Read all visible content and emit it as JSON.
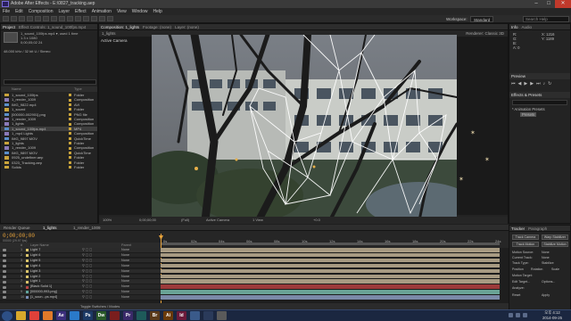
{
  "window": {
    "title": "Adobe After Effects - E:\\0827_tracking.aep",
    "min": "–",
    "max": "□",
    "close": "✕"
  },
  "menu": [
    "File",
    "Edit",
    "Composition",
    "Layer",
    "Effect",
    "Animation",
    "View",
    "Window",
    "Help"
  ],
  "toolbar": {
    "workspace_label": "Workspace:",
    "workspace_value": "Standard",
    "search_placeholder": "Search Help"
  },
  "project": {
    "tabs": [
      "Project",
      "Effect Controls: 1_sound_100fps.mp4"
    ],
    "item_name": "1_sound_100fps.mp4 ▾, used 1 time",
    "item_info1": "1.3 x 1080",
    "item_info2": "0;00;05;02 24",
    "item_info3": "48.000 kHz / 32 bit U / Stereo",
    "columns": {
      "name": "Name",
      "label": "",
      "type": "Type"
    },
    "items": [
      {
        "name": "1_sound_100fps",
        "type": "Folder",
        "color": "#c9a43b",
        "icon": "folder-icon"
      },
      {
        "name": "1_render_1009",
        "type": "Composition",
        "color": "#8a7ab8",
        "icon": "composition-icon"
      },
      {
        "name": "IMG_9822.mp4",
        "type": "AVI",
        "color": "#5a8fc9",
        "icon": "footage-icon"
      },
      {
        "name": "1_sound",
        "type": "Folder",
        "color": "#c9a43b",
        "icon": "folder-icon"
      },
      {
        "name": "[000000-002901].png",
        "type": "PNG file",
        "color": "#5a8fc9",
        "icon": "footage-icon"
      },
      {
        "name": "1_render_1009",
        "type": "Composition",
        "color": "#8a7ab8",
        "icon": "composition-icon"
      },
      {
        "name": "1_lights",
        "type": "Composition",
        "color": "#8a7ab8",
        "icon": "composition-icon"
      },
      {
        "name": "1_sound_100fps.mp4",
        "type": "MP4",
        "color": "#5a8fc9",
        "icon": "footage-icon",
        "selected": true
      },
      {
        "name": "1_mp4 Lights",
        "type": "Composition",
        "color": "#8a7ab8",
        "icon": "composition-icon"
      },
      {
        "name": "IMG_9897.MOV",
        "type": "QuickTime",
        "color": "#5a8fc9",
        "icon": "footage-icon"
      },
      {
        "name": "1_lights",
        "type": "Folder",
        "color": "#c9a43b",
        "icon": "folder-icon"
      },
      {
        "name": "1_render_1009",
        "type": "Composition",
        "color": "#8a7ab8",
        "icon": "composition-icon"
      },
      {
        "name": "IMG_9897.MOV",
        "type": "QuickTime",
        "color": "#5a8fc9",
        "icon": "footage-icon"
      },
      {
        "name": "0925_undefiner.aep",
        "type": "Folder",
        "color": "#c9a43b",
        "icon": "folder-icon"
      },
      {
        "name": "0323_Tracking.aep",
        "type": "Folder",
        "color": "#c9a43b",
        "icon": "folder-icon"
      },
      {
        "name": "Solids",
        "type": "Folder",
        "color": "#c9a43b",
        "icon": "folder-icon"
      }
    ],
    "footer": "8 bpc"
  },
  "composition": {
    "tabs": [
      "Composition: 1_lights",
      "Footage: (none)",
      "Layer: (none)"
    ],
    "subtab": "1_lights",
    "camera_label": "Active Camera",
    "renderer": "Renderer: Classic 3D",
    "footer": {
      "zoom": "100%",
      "timecode": "0;00;00;00",
      "resolution": "(Full)",
      "camera": "Active Camera",
      "views": "1 View",
      "offset": "+0.0"
    }
  },
  "right": {
    "info_tab": "Info",
    "audio_tab": "Audio",
    "info": [
      "R:",
      "G:",
      "B:",
      "A: 0",
      "X: 1216",
      "Y: 1189"
    ],
    "preview_tab": "Preview",
    "effects_tab": "Effects & Presets",
    "effects_search": "",
    "effects_item1": "* Animation Presets",
    "effects_item2": "Presets"
  },
  "timeline": {
    "tabs": [
      "Render Queue",
      "1_lights",
      "1_render_1009"
    ],
    "timecode": "0;00;00;00",
    "fps": "00000 (29.97 fps)",
    "columns": {
      "num": "#",
      "name": "Layer Name",
      "switches": "",
      "parent": "Parent"
    },
    "ticks": [
      "0s",
      "02s",
      "04s",
      "06s",
      "08s",
      "10s",
      "12s",
      "14s",
      "16s",
      "18s",
      "20s",
      "22s",
      "24s"
    ],
    "layers": [
      {
        "num": "1",
        "name": "Light 7",
        "color": "#d9c36a",
        "parent": "None",
        "bar": "#a79a82"
      },
      {
        "num": "2",
        "name": "Light 6",
        "color": "#d9c36a",
        "parent": "None",
        "bar": "#a79a82"
      },
      {
        "num": "3",
        "name": "Light 5",
        "color": "#d9c36a",
        "parent": "None",
        "bar": "#a79a82"
      },
      {
        "num": "4",
        "name": "Light 4",
        "color": "#d9c36a",
        "parent": "None",
        "bar": "#a79a82"
      },
      {
        "num": "5",
        "name": "Light 3",
        "color": "#d9c36a",
        "parent": "None",
        "bar": "#a79a82"
      },
      {
        "num": "6",
        "name": "Light 2",
        "color": "#d9c36a",
        "parent": "None",
        "bar": "#a79a82"
      },
      {
        "num": "7",
        "name": "Light 1",
        "color": "#d9c36a",
        "parent": "None",
        "bar": "#a79a82"
      },
      {
        "num": "8",
        "name": "[Black Solid 1]",
        "color": "#b84444",
        "parent": "None",
        "bar": "#9c3a3a"
      },
      {
        "num": "9",
        "name": "[000000-993.png]",
        "color": "#5fa39a",
        "parent": "None",
        "bar": "#6aa396"
      },
      {
        "num": "10",
        "name": "[1_soun...ps.mp4]",
        "color": "#7a8fb8",
        "parent": "None",
        "bar": "#7b8aa8"
      }
    ],
    "footer": "Toggle Switches / Modes"
  },
  "tracker": {
    "tabs": [
      "Tracker",
      "Paragraph"
    ],
    "labels": [
      "Track Camera",
      "Warp Stabilizer",
      "Track Motion",
      "Stabilize Motion",
      "Motion Source:",
      "Current Track:",
      "Track Type:",
      "Position",
      "Rotation",
      "Scale",
      "Motion Target:",
      "Edit Target...",
      "Options...",
      "Analyze:",
      "Reset",
      "Apply"
    ],
    "motion_source": "None",
    "current_track": "None",
    "track_type": "Stabilize"
  },
  "taskbar": {
    "apps": [
      {
        "icon": "start-icon",
        "label": "",
        "color": "#2d4f86"
      },
      {
        "icon": "explorer-icon",
        "label": "",
        "color": "#d8a82c"
      },
      {
        "icon": "chrome-icon",
        "label": "",
        "color": "#e0413a"
      },
      {
        "icon": "firefox-icon",
        "label": "",
        "color": "#e07a2a"
      },
      {
        "icon": "aftereffects-icon",
        "label": "Ae",
        "color": "#3b2f7d"
      },
      {
        "icon": "media-icon",
        "label": "",
        "color": "#2a7ac9"
      },
      {
        "icon": "photoshop-icon",
        "label": "Ps",
        "color": "#1c3a66"
      },
      {
        "icon": "dreamweaver-icon",
        "label": "Dw",
        "color": "#2a5a2a"
      },
      {
        "icon": "flash-icon",
        "label": "",
        "color": "#7a1e1e"
      },
      {
        "icon": "premiere-icon",
        "label": "Pr",
        "color": "#3a2a6a"
      },
      {
        "icon": "audition-icon",
        "label": "",
        "color": "#1e5a5a"
      },
      {
        "icon": "bridge-icon",
        "label": "Br",
        "color": "#5a3a1a"
      },
      {
        "icon": "illustrator-icon",
        "label": "Ai",
        "color": "#6a3a0a"
      },
      {
        "icon": "indesign-icon",
        "label": "Id",
        "color": "#6a1a3a"
      },
      {
        "icon": "app-icon",
        "label": "",
        "color": "#3a5a8a"
      },
      {
        "icon": "app2-icon",
        "label": "",
        "color": "#2a3a5a"
      },
      {
        "icon": "app3-icon",
        "label": "",
        "color": "#5a5a5a"
      }
    ],
    "time": "오후 4:12",
    "date": "2014-09-25"
  }
}
